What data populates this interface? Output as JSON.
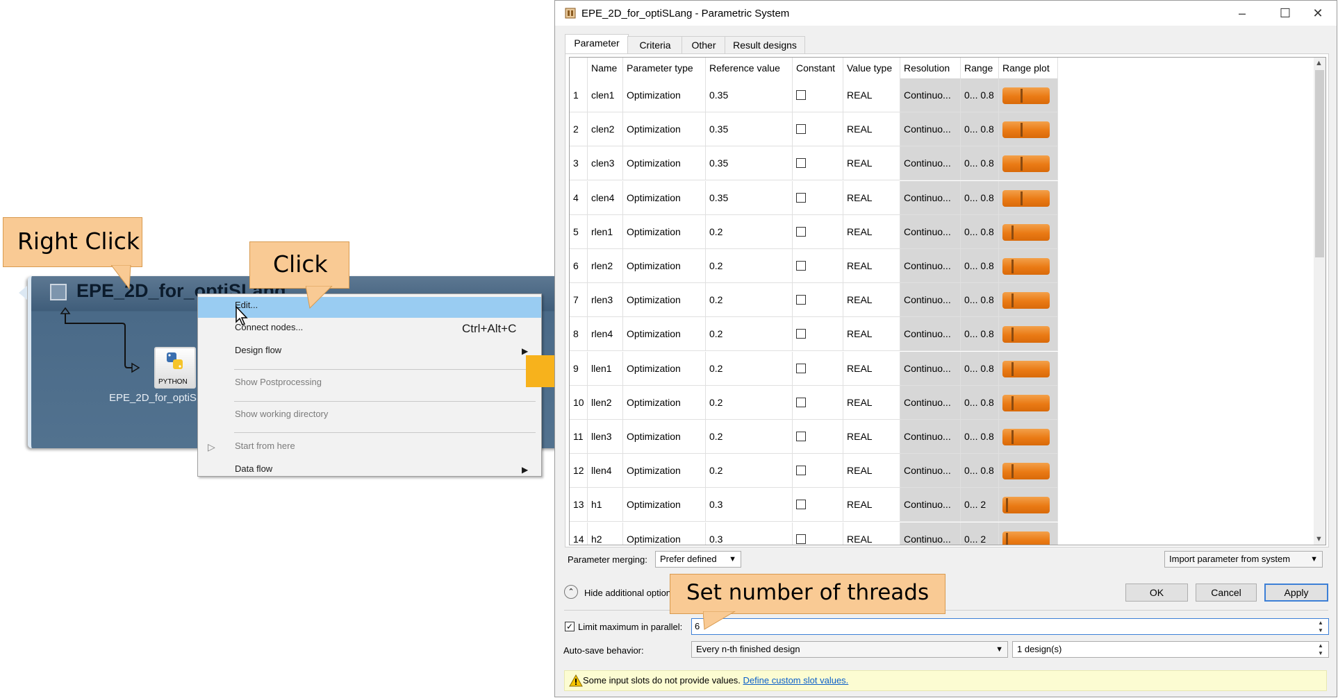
{
  "canvas": {
    "node_title": "EPE_2D_for_optiSLang",
    "sub_label": "EPE_2D_for_optiSL",
    "python_label": "PYTHON"
  },
  "context_menu": {
    "items": [
      {
        "label": "Edit...",
        "shortcut": "",
        "state": "highlighted"
      },
      {
        "label": "Connect nodes...",
        "shortcut": "Ctrl+Alt+C",
        "state": "enabled"
      },
      {
        "label": "Design flow",
        "shortcut": "",
        "state": "enabled",
        "submenu": true
      },
      {
        "label": "Show Postprocessing",
        "shortcut": "",
        "state": "disabled"
      },
      {
        "label": "Show working directory",
        "shortcut": "",
        "state": "disabled"
      },
      {
        "label": "Start from here",
        "shortcut": "",
        "state": "disabled"
      },
      {
        "label": "Data flow",
        "shortcut": "",
        "state": "enabled",
        "submenu": true
      }
    ]
  },
  "callouts": {
    "right_click": "Right Click",
    "click": "Click",
    "threads": "Set number of threads"
  },
  "dialog": {
    "title": "EPE_2D_for_optiSLang - Parametric System",
    "tabs": [
      "Parameter",
      "Criteria",
      "Other",
      "Result designs"
    ],
    "active_tab": "Parameter",
    "columns": [
      "Name",
      "Parameter type",
      "Reference value",
      "Constant",
      "Value type",
      "Resolution",
      "Range",
      "Range plot"
    ],
    "rows": [
      {
        "num": "1",
        "name": "clen1",
        "ptype": "Optimization",
        "ref": "0.35",
        "constant": false,
        "vtype": "REAL",
        "res": "Continuo...",
        "range_lo": "0...",
        "range_hi": "0.8",
        "ref_fraction": 0.4
      },
      {
        "num": "2",
        "name": "clen2",
        "ptype": "Optimization",
        "ref": "0.35",
        "constant": false,
        "vtype": "REAL",
        "res": "Continuo...",
        "range_lo": "0...",
        "range_hi": "0.8",
        "ref_fraction": 0.4
      },
      {
        "num": "3",
        "name": "clen3",
        "ptype": "Optimization",
        "ref": "0.35",
        "constant": false,
        "vtype": "REAL",
        "res": "Continuo...",
        "range_lo": "0...",
        "range_hi": "0.8",
        "ref_fraction": 0.4
      },
      {
        "num": "4",
        "name": "clen4",
        "ptype": "Optimization",
        "ref": "0.35",
        "constant": false,
        "vtype": "REAL",
        "res": "Continuo...",
        "range_lo": "0...",
        "range_hi": "0.8",
        "ref_fraction": 0.4
      },
      {
        "num": "5",
        "name": "rlen1",
        "ptype": "Optimization",
        "ref": "0.2",
        "constant": false,
        "vtype": "REAL",
        "res": "Continuo...",
        "range_lo": "0...",
        "range_hi": "0.8",
        "ref_fraction": 0.2
      },
      {
        "num": "6",
        "name": "rlen2",
        "ptype": "Optimization",
        "ref": "0.2",
        "constant": false,
        "vtype": "REAL",
        "res": "Continuo...",
        "range_lo": "0...",
        "range_hi": "0.8",
        "ref_fraction": 0.2
      },
      {
        "num": "7",
        "name": "rlen3",
        "ptype": "Optimization",
        "ref": "0.2",
        "constant": false,
        "vtype": "REAL",
        "res": "Continuo...",
        "range_lo": "0...",
        "range_hi": "0.8",
        "ref_fraction": 0.2
      },
      {
        "num": "8",
        "name": "rlen4",
        "ptype": "Optimization",
        "ref": "0.2",
        "constant": false,
        "vtype": "REAL",
        "res": "Continuo...",
        "range_lo": "0...",
        "range_hi": "0.8",
        "ref_fraction": 0.2
      },
      {
        "num": "9",
        "name": "llen1",
        "ptype": "Optimization",
        "ref": "0.2",
        "constant": false,
        "vtype": "REAL",
        "res": "Continuo...",
        "range_lo": "0...",
        "range_hi": "0.8",
        "ref_fraction": 0.2
      },
      {
        "num": "10",
        "name": "llen2",
        "ptype": "Optimization",
        "ref": "0.2",
        "constant": false,
        "vtype": "REAL",
        "res": "Continuo...",
        "range_lo": "0...",
        "range_hi": "0.8",
        "ref_fraction": 0.2
      },
      {
        "num": "11",
        "name": "llen3",
        "ptype": "Optimization",
        "ref": "0.2",
        "constant": false,
        "vtype": "REAL",
        "res": "Continuo...",
        "range_lo": "0...",
        "range_hi": "0.8",
        "ref_fraction": 0.2
      },
      {
        "num": "12",
        "name": "llen4",
        "ptype": "Optimization",
        "ref": "0.2",
        "constant": false,
        "vtype": "REAL",
        "res": "Continuo...",
        "range_lo": "0...",
        "range_hi": "0.8",
        "ref_fraction": 0.2
      },
      {
        "num": "13",
        "name": "h1",
        "ptype": "Optimization",
        "ref": "0.3",
        "constant": false,
        "vtype": "REAL",
        "res": "Continuo...",
        "range_lo": "0...",
        "range_hi": "2",
        "ref_fraction": 0.08
      },
      {
        "num": "14",
        "name": "h2",
        "ptype": "Optimization",
        "ref": "0.3",
        "constant": false,
        "vtype": "REAL",
        "res": "Continuo...",
        "range_lo": "0...",
        "range_hi": "2",
        "ref_fraction": 0.08
      }
    ],
    "parameter_merging_label": "Parameter merging:",
    "parameter_merging_value": "Prefer defined",
    "import_button": "Import parameter from system",
    "hide_options_label": "Hide additional options",
    "ok_button": "OK",
    "cancel_button": "Cancel",
    "apply_button": "Apply",
    "limit_parallel_label": "Limit maximum in parallel:",
    "limit_parallel_checked": true,
    "limit_parallel_value": "6",
    "autosave_label": "Auto-save behavior:",
    "autosave_value": "Every n-th finished design",
    "autosave_count": "1 design(s)",
    "warning_text": "Some input slots do not provide values.",
    "warning_link": "Define custom slot values."
  },
  "colors": {
    "range_bar": "#ea7a14",
    "highlight": "#99ccf2",
    "callout": "#f9ca94",
    "arrow": "#f7b21c"
  }
}
